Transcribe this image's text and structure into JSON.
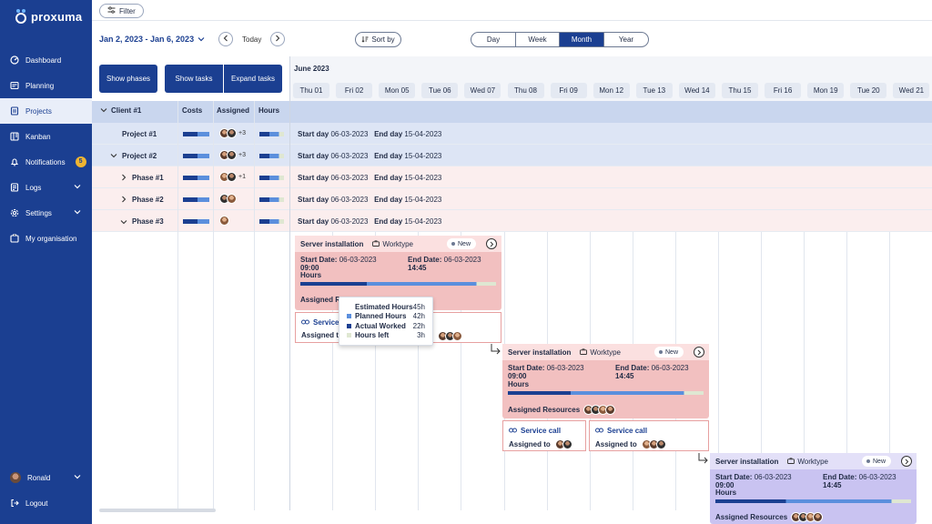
{
  "app": {
    "name": "proxuma"
  },
  "sidebar": {
    "items": [
      {
        "label": "Dashboard",
        "icon": "dashboard-icon"
      },
      {
        "label": "Planning",
        "icon": "planning-icon"
      },
      {
        "label": "Projects",
        "icon": "projects-icon",
        "active": true
      },
      {
        "label": "Kanban",
        "icon": "kanban-icon"
      },
      {
        "label": "Notifications",
        "icon": "bell-icon",
        "badge": "5"
      },
      {
        "label": "Logs",
        "icon": "logs-icon"
      },
      {
        "label": "Settings",
        "icon": "gear-icon"
      },
      {
        "label": "My organisation",
        "icon": "organisation-icon"
      }
    ],
    "user": {
      "name": "Ronald"
    },
    "logout": "Logout"
  },
  "toolbar": {
    "filter_label": "Filter",
    "date_range": "Jan 2, 2023 - Jan 6, 2023",
    "today_label": "Today",
    "sort_label": "Sort by",
    "views": [
      "Day",
      "Week",
      "Month",
      "Year"
    ],
    "active_view": "Month"
  },
  "grid": {
    "buttons": {
      "show_phases": "Show phases",
      "show_tasks": "Show tasks",
      "expand_tasks": "Expand tasks"
    },
    "columns": {
      "costs": "Costs",
      "assigned": "Assigned",
      "hours": "Hours"
    },
    "client_label": "Client #1",
    "rows": [
      {
        "label": "Project #1",
        "plus": "+3",
        "start_label": "Start day",
        "start": "06-03-2023",
        "end_label": "End day",
        "end": "15-04-2023"
      },
      {
        "label": "Project #2",
        "plus": "+3",
        "start_label": "Start day",
        "start": "06-03-2023",
        "end_label": "End day",
        "end": "15-04-2023"
      },
      {
        "label": "Phase #1",
        "plus": "+1",
        "start_label": "Start day",
        "start": "06-03-2023",
        "end_label": "End day",
        "end": "15-04-2023"
      },
      {
        "label": "Phase #2",
        "plus": "",
        "start_label": "Start day",
        "start": "06-03-2023",
        "end_label": "End day",
        "end": "15-04-2023"
      },
      {
        "label": "Phase #3",
        "plus": "",
        "start_label": "Start day",
        "start": "06-03-2023",
        "end_label": "End day",
        "end": "15-04-2023"
      }
    ]
  },
  "timeline": {
    "month": "June 2023",
    "days": [
      "Thu 01",
      "Fri 02",
      "Mon 05",
      "Tue 06",
      "Wed 07",
      "Thu 08",
      "Fri 09",
      "Mon 12",
      "Tue 13",
      "Wed 14",
      "Thu 15",
      "Fri 16",
      "Mon 19",
      "Tue 20",
      "Wed 21"
    ]
  },
  "cards": [
    {
      "title": "Server installation",
      "worktype": "Worktype",
      "status": "New",
      "start_label": "Start Date:",
      "start_date": "06-03-2023",
      "start_time": "09:00",
      "end_label": "End Date:",
      "end_date": "06-03-2023",
      "end_time": "14:45",
      "hours_label": "Hours",
      "resources_label": "Assigned Resources"
    },
    {
      "title": "Server installation",
      "worktype": "Worktype",
      "status": "New",
      "start_label": "Start Date:",
      "start_date": "06-03-2023",
      "start_time": "09:00",
      "end_label": "End Date:",
      "end_date": "06-03-2023",
      "end_time": "14:45",
      "hours_label": "Hours",
      "resources_label": "Assigned Resources"
    },
    {
      "title": "Server installation",
      "worktype": "Worktype",
      "status": "New",
      "start_label": "Start Date:",
      "start_date": "06-03-2023",
      "start_time": "09:00",
      "end_label": "End Date:",
      "end_date": "06-03-2023",
      "end_time": "14:45",
      "hours_label": "Hours",
      "resources_label": "Assigned Resources"
    }
  ],
  "service_calls": {
    "title": "Service call",
    "assigned_label": "Assigned to"
  },
  "tooltip": {
    "rows": [
      {
        "label": "Estimated Hours",
        "value": "45h",
        "color": ""
      },
      {
        "label": "Planned Hours",
        "value": "42h",
        "color": "#5b8fdd"
      },
      {
        "label": "Actual Worked",
        "value": "22h",
        "color": "#1b3f91"
      },
      {
        "label": "Hours left",
        "value": "3h",
        "color": "#dfe7d2"
      }
    ]
  },
  "colors": {
    "brand": "#1b3f91",
    "card_red": "#f5c9c9",
    "card_purple": "#c8c3f0"
  }
}
